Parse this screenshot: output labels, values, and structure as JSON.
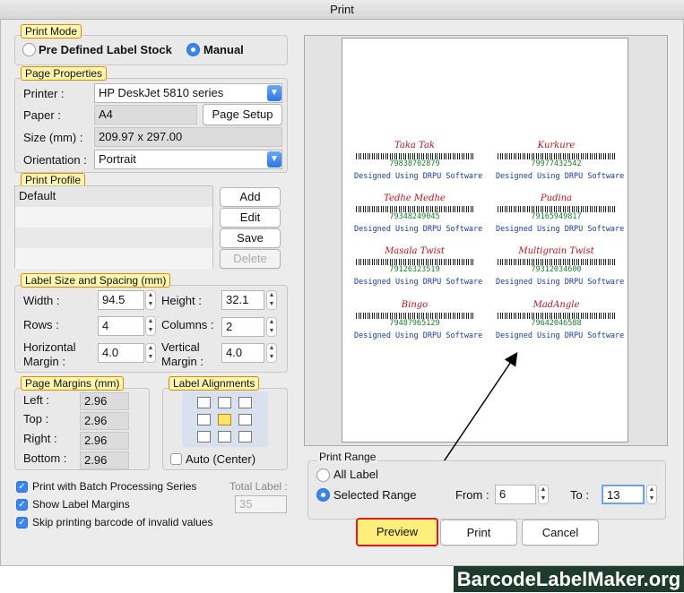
{
  "window": {
    "title": "Print"
  },
  "print_mode": {
    "title": "Print Mode",
    "option1": "Pre Defined Label Stock",
    "option2": "Manual",
    "selected": "Manual"
  },
  "page_properties": {
    "title": "Page Properties",
    "printer_label": "Printer :",
    "printer_value": "HP DeskJet 5810 series",
    "paper_label": "Paper :",
    "paper_value": "A4",
    "page_setup": "Page Setup",
    "size_label": "Size (mm) :",
    "size_value": "209.97 x 297.00",
    "orientation_label": "Orientation :",
    "orientation_value": "Portrait"
  },
  "print_profile": {
    "title": "Print Profile",
    "items": [
      "Default"
    ],
    "add": "Add",
    "edit": "Edit",
    "save": "Save",
    "delete": "Delete"
  },
  "label_size": {
    "title": "Label Size and Spacing (mm)",
    "width_label": "Width :",
    "width_value": "94.5",
    "height_label": "Height :",
    "height_value": "32.1",
    "rows_label": "Rows :",
    "rows_value": "4",
    "columns_label": "Columns :",
    "columns_value": "2",
    "hmargin_label1": "Horizontal",
    "hmargin_label2": "Margin :",
    "hmargin_value": "4.0",
    "vmargin_label1": "Vertical",
    "vmargin_label2": "Margin :",
    "vmargin_value": "4.0"
  },
  "page_margins": {
    "title": "Page Margins (mm)",
    "left_label": "Left :",
    "left_value": "2.96",
    "top_label": "Top :",
    "top_value": "2.96",
    "right_label": "Right :",
    "right_value": "2.96",
    "bottom_label": "Bottom :",
    "bottom_value": "2.96"
  },
  "label_alignments": {
    "title": "Label Alignments",
    "auto_center": "Auto (Center)",
    "selected": "middle-center"
  },
  "options": {
    "batch": "Print with Batch Processing Series",
    "show_margins": "Show Label Margins",
    "skip_invalid": "Skip printing barcode of invalid values",
    "total_label": "Total Label :",
    "total_value": "35"
  },
  "preview_labels": [
    {
      "name": "Taka Tak",
      "number": "79838702879"
    },
    {
      "name": "Kurkure",
      "number": "79977432542"
    },
    {
      "name": "Tedhe Medhe",
      "number": "79348249045"
    },
    {
      "name": "Pudina",
      "number": "79165949817"
    },
    {
      "name": "Masala Twist",
      "number": "79126323519"
    },
    {
      "name": "Multigrain Twist",
      "number": "79312034600"
    },
    {
      "name": "Bingo",
      "number": "79487965129"
    },
    {
      "name": "MadAngle",
      "number": "79642046588"
    }
  ],
  "preview_footer": "Designed Using DRPU Software",
  "print_range": {
    "title": "Print Range",
    "all": "All Label",
    "selected": "Selected Range",
    "from_label": "From :",
    "from_value": "6",
    "to_label": "To :",
    "to_value": "13"
  },
  "buttons": {
    "preview": "Preview",
    "print": "Print",
    "cancel": "Cancel"
  },
  "brand": "BarcodeLabelMaker.org"
}
